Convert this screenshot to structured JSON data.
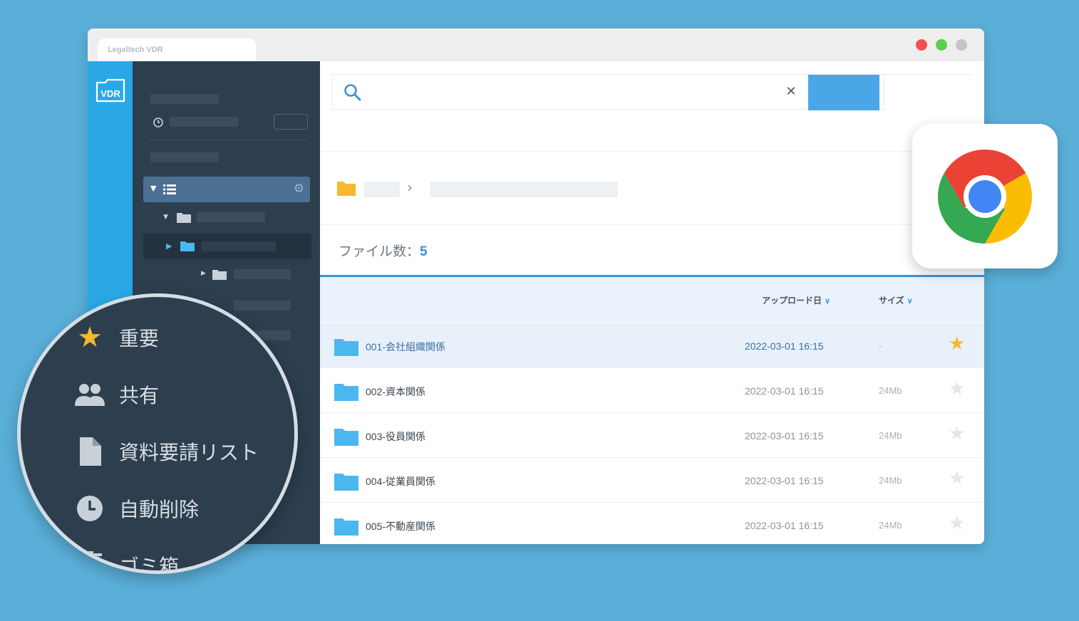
{
  "window": {
    "tab_title": "Legaltech VDR",
    "traffic_colors": [
      "#f05252",
      "#5bd14a",
      "#c4c4c4"
    ]
  },
  "rail": {
    "logo_text": "VDR"
  },
  "search": {
    "value": "",
    "placeholder": "",
    "clear_icon": "close-icon"
  },
  "file_count": {
    "label": "ファイル数：",
    "value": "5"
  },
  "table": {
    "columns": {
      "upload_date": "アップロード日",
      "size": "サイズ"
    },
    "rows": [
      {
        "name": "001-会社組織関係",
        "date": "2022-03-01 16:15",
        "size": "-",
        "starred": true,
        "selected": true
      },
      {
        "name": "002-資本関係",
        "date": "2022-03-01 16:15",
        "size": "24Mb",
        "starred": false,
        "selected": false
      },
      {
        "name": "003-役員関係",
        "date": "2022-03-01 16:15",
        "size": "24Mb",
        "starred": false,
        "selected": false
      },
      {
        "name": "004-従業員関係",
        "date": "2022-03-01 16:15",
        "size": "24Mb",
        "starred": false,
        "selected": false
      },
      {
        "name": "005-不動産関係",
        "date": "2022-03-01 16:15",
        "size": "24Mb",
        "starred": false,
        "selected": false
      }
    ]
  },
  "magnifier": {
    "items": [
      {
        "label": "重要",
        "icon": "star-icon"
      },
      {
        "label": "共有",
        "icon": "people-icon"
      },
      {
        "label": "資料要請リスト",
        "icon": "document-icon"
      },
      {
        "label": "自動削除",
        "icon": "clock-icon"
      },
      {
        "label": "ゴミ箱",
        "icon": "trash-icon"
      }
    ]
  },
  "colors": {
    "accent": "#3a93d9",
    "star_active": "#f5b82e",
    "sidebar": "#2d3e4f",
    "rail": "#2aa8e6",
    "folder": "#4ab8ef"
  }
}
